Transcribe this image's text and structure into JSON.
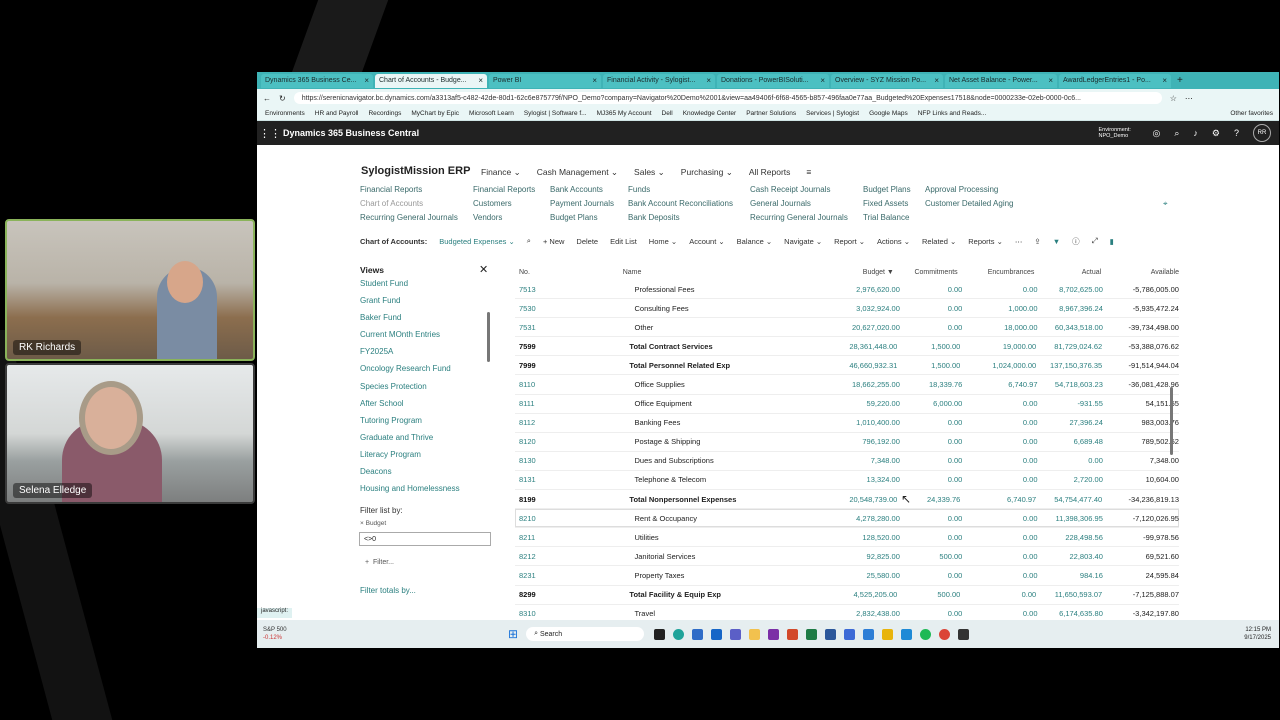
{
  "participants": [
    {
      "name": "RK Richards"
    },
    {
      "name": "Selena Elledge"
    }
  ],
  "browser": {
    "tabs": [
      {
        "label": "Dynamics 365 Business Ce..."
      },
      {
        "label": "Chart of Accounts - Budge..."
      },
      {
        "label": "Power BI"
      },
      {
        "label": "Financial Activity - Sylogist..."
      },
      {
        "label": "Donations - PowerBISoluti..."
      },
      {
        "label": "Overview - SYZ Mission Po..."
      },
      {
        "label": "Net Asset Balance - Power..."
      },
      {
        "label": "AwardLedgerEntries1 - Po..."
      }
    ],
    "url": "https://serenicnavigator.bc.dynamics.com/a3313af5-c482-42de-80d1-62c6e875779f/NPO_Demo?company=Navigator%20Demo%2001&view=aa49406f-6f68-4565-b857-496faa0e77aa_Budgeted%20Expenses17518&node=0000233e-02eb-0000-0c6...",
    "favorites": [
      "Environments",
      "HR and Payroll",
      "Recordings",
      "MyChart by Epic",
      "Microsoft Learn",
      "Sylogist | Software f...",
      "MJ365 My Account",
      "Dell",
      "Knowledge Center",
      "Partner Solutions",
      "Services | Sylogist",
      "Google Maps",
      "NFP Links and Reads...",
      "Other favorites"
    ]
  },
  "app": {
    "title": "Dynamics 365 Business Central",
    "environment": "Environment: NPO_Demo",
    "user_initials": "RR",
    "company": "SylogistMission ERP",
    "nav": [
      "Finance",
      "Cash Management",
      "Sales",
      "Purchasing",
      "All Reports"
    ],
    "menu_links": [
      [
        "Financial Reports",
        "Chart of Accounts",
        "Recurring General Journals"
      ],
      [
        "Financial Reports",
        "Customers",
        "Vendors"
      ],
      [
        "Bank Accounts",
        "Payment Journals",
        "Budget Plans"
      ],
      [
        "Funds",
        "Bank Account Reconciliations",
        "Bank Deposits"
      ],
      [
        "Cash Receipt Journals",
        "General Journals",
        "Recurring General Journals"
      ],
      [
        "Budget Plans",
        "Fixed Assets",
        "Trial Balance"
      ],
      [
        "Approval Processing",
        "Customer Detailed Aging",
        ""
      ]
    ],
    "page_label": "Chart of Accounts:",
    "view_label": "Budgeted Expenses",
    "actions": [
      "+ New",
      "Delete",
      "Edit List",
      "Home",
      "Account",
      "Balance",
      "Navigate",
      "Report",
      "Actions",
      "Related",
      "Reports"
    ],
    "views_title": "Views",
    "views": [
      "Student Fund",
      "Grant Fund",
      "Baker Fund",
      "Current MOnth Entries",
      "FY2025A",
      "Oncology Research Fund",
      "Species Protection",
      "After School",
      "Tutoring Program",
      "Graduate and Thrive",
      "Literacy Program",
      "Deacons",
      "Housing and Homelessness"
    ],
    "filter_list_by": "Filter list by:",
    "filter_field": "Budget",
    "filter_value": "<>0",
    "add_filter": "Filter...",
    "filter_totals": "Filter totals by...",
    "columns": [
      "No.",
      "Name",
      "Budget",
      "Commitments",
      "Encumbrances",
      "Actual",
      "Available"
    ],
    "rows": [
      {
        "no": "7513",
        "name": "Professional Fees",
        "budget": "2,976,620.00",
        "commit": "0.00",
        "enc": "0.00",
        "actual": "8,702,625.00",
        "avail": "-5,786,005.00",
        "total": false
      },
      {
        "no": "7530",
        "name": "Consulting Fees",
        "budget": "3,032,924.00",
        "commit": "0.00",
        "enc": "1,000.00",
        "actual": "8,967,396.24",
        "avail": "-5,935,472.24",
        "total": false
      },
      {
        "no": "7531",
        "name": "Other",
        "budget": "20,627,020.00",
        "commit": "0.00",
        "enc": "18,000.00",
        "actual": "60,343,518.00",
        "avail": "-39,734,498.00",
        "total": false
      },
      {
        "no": "7599",
        "name": "Total Contract Services",
        "budget": "28,361,448.00",
        "commit": "1,500.00",
        "enc": "19,000.00",
        "actual": "81,729,024.62",
        "avail": "-53,388,076.62",
        "total": true
      },
      {
        "no": "7999",
        "name": "Total Personnel Related Exp",
        "budget": "46,660,932.31",
        "commit": "1,500.00",
        "enc": "1,024,000.00",
        "actual": "137,150,376.35",
        "avail": "-91,514,944.04",
        "total": true
      },
      {
        "no": "8110",
        "name": "Office Supplies",
        "budget": "18,662,255.00",
        "commit": "18,339.76",
        "enc": "6,740.97",
        "actual": "54,718,603.23",
        "avail": "-36,081,428.96",
        "total": false
      },
      {
        "no": "8111",
        "name": "Office Equipment",
        "budget": "59,220.00",
        "commit": "6,000.00",
        "enc": "0.00",
        "actual": "-931.55",
        "avail": "54,151.55",
        "total": false
      },
      {
        "no": "8112",
        "name": "Banking Fees",
        "budget": "1,010,400.00",
        "commit": "0.00",
        "enc": "0.00",
        "actual": "27,396.24",
        "avail": "983,003.76",
        "total": false
      },
      {
        "no": "8120",
        "name": "Postage & Shipping",
        "budget": "796,192.00",
        "commit": "0.00",
        "enc": "0.00",
        "actual": "6,689.48",
        "avail": "789,502.52",
        "total": false
      },
      {
        "no": "8130",
        "name": "Dues and Subscriptions",
        "budget": "7,348.00",
        "commit": "0.00",
        "enc": "0.00",
        "actual": "0.00",
        "avail": "7,348.00",
        "total": false
      },
      {
        "no": "8131",
        "name": "Telephone & Telecom",
        "budget": "13,324.00",
        "commit": "0.00",
        "enc": "0.00",
        "actual": "2,720.00",
        "avail": "10,604.00",
        "total": false
      },
      {
        "no": "8199",
        "name": "Total Nonpersonnel Expenses",
        "budget": "20,548,739.00",
        "commit": "24,339.76",
        "enc": "6,740.97",
        "actual": "54,754,477.40",
        "avail": "-34,236,819.13",
        "total": true
      },
      {
        "no": "8210",
        "name": "Rent & Occupancy",
        "budget": "4,278,280.00",
        "commit": "0.00",
        "enc": "0.00",
        "actual": "11,398,306.95",
        "avail": "-7,120,026.95",
        "total": false
      },
      {
        "no": "8211",
        "name": "Utilities",
        "budget": "128,520.00",
        "commit": "0.00",
        "enc": "0.00",
        "actual": "228,498.56",
        "avail": "-99,978.56",
        "total": false
      },
      {
        "no": "8212",
        "name": "Janitorial Services",
        "budget": "92,825.00",
        "commit": "500.00",
        "enc": "0.00",
        "actual": "22,803.40",
        "avail": "69,521.60",
        "total": false
      },
      {
        "no": "8231",
        "name": "Property Taxes",
        "budget": "25,580.00",
        "commit": "0.00",
        "enc": "0.00",
        "actual": "984.16",
        "avail": "24,595.84",
        "total": false
      },
      {
        "no": "8299",
        "name": "Total Facility & Equip Exp",
        "budget": "4,525,205.00",
        "commit": "500.00",
        "enc": "0.00",
        "actual": "11,650,593.07",
        "avail": "-7,125,888.07",
        "total": true
      },
      {
        "no": "8310",
        "name": "Travel",
        "budget": "2,832,438.00",
        "commit": "0.00",
        "enc": "0.00",
        "actual": "6,174,635.80",
        "avail": "-3,342,197.80",
        "total": false
      }
    ],
    "status_text": "javascript:"
  },
  "taskbar": {
    "stock_name": "S&P 500",
    "stock_change": "-0.12%",
    "search": "Search",
    "time": "12:15 PM",
    "date": "9/17/2025"
  }
}
